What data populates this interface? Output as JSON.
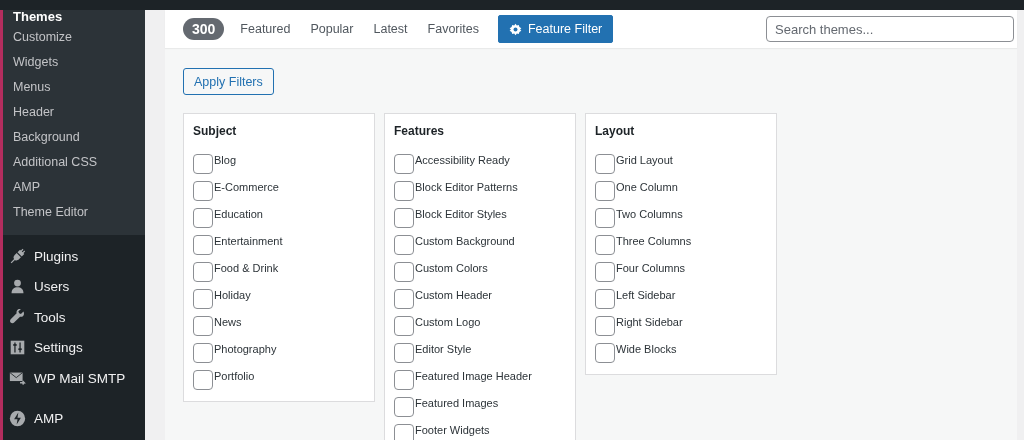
{
  "sidebar": {
    "submenu": [
      {
        "label": "Themes",
        "selected": true
      },
      {
        "label": "Customize",
        "selected": false
      },
      {
        "label": "Widgets",
        "selected": false
      },
      {
        "label": "Menus",
        "selected": false
      },
      {
        "label": "Header",
        "selected": false
      },
      {
        "label": "Background",
        "selected": false
      },
      {
        "label": "Additional CSS",
        "selected": false
      },
      {
        "label": "AMP",
        "selected": false
      },
      {
        "label": "Theme Editor",
        "selected": false
      }
    ],
    "menu": [
      {
        "label": "Plugins",
        "kind": "plugin"
      },
      {
        "label": "Users",
        "kind": "user"
      },
      {
        "label": "Tools",
        "kind": "wrench"
      },
      {
        "label": "Settings",
        "kind": "sliders"
      },
      {
        "label": "WP Mail SMTP",
        "kind": "mail"
      },
      {
        "label": "AMP",
        "kind": "bolt"
      }
    ]
  },
  "filter_bar": {
    "count": "300",
    "tabs": [
      {
        "label": "Featured",
        "selected": false
      },
      {
        "label": "Popular",
        "selected": false
      },
      {
        "label": "Latest",
        "selected": false
      },
      {
        "label": "Favorites",
        "selected": false
      },
      {
        "label": "Feature Filter",
        "selected": true
      }
    ],
    "search": {
      "placeholder": "Search themes..."
    }
  },
  "apply_button": "Apply Filters",
  "groups": [
    {
      "title": "Subject",
      "options": [
        {
          "label": "Blog",
          "checked": false
        },
        {
          "label": "E-Commerce",
          "checked": false
        },
        {
          "label": "Education",
          "checked": false
        },
        {
          "label": "Entertainment",
          "checked": false
        },
        {
          "label": "Food & Drink",
          "checked": false
        },
        {
          "label": "Holiday",
          "checked": false
        },
        {
          "label": "News",
          "checked": false
        },
        {
          "label": "Photography",
          "checked": false
        },
        {
          "label": "Portfolio",
          "checked": false
        }
      ]
    },
    {
      "title": "Features",
      "options": [
        {
          "label": "Accessibility Ready",
          "checked": false
        },
        {
          "label": "Block Editor Patterns",
          "checked": false
        },
        {
          "label": "Block Editor Styles",
          "checked": false
        },
        {
          "label": "Custom Background",
          "checked": false
        },
        {
          "label": "Custom Colors",
          "checked": false
        },
        {
          "label": "Custom Header",
          "checked": false
        },
        {
          "label": "Custom Logo",
          "checked": false
        },
        {
          "label": "Editor Style",
          "checked": false
        },
        {
          "label": "Featured Image Header",
          "checked": false
        },
        {
          "label": "Featured Images",
          "checked": false
        },
        {
          "label": "Footer Widgets",
          "checked": false
        }
      ]
    },
    {
      "title": "Layout",
      "options": [
        {
          "label": "Grid Layout",
          "checked": false
        },
        {
          "label": "One Column",
          "checked": false
        },
        {
          "label": "Two Columns",
          "checked": false
        },
        {
          "label": "Three Columns",
          "checked": false
        },
        {
          "label": "Four Columns",
          "checked": false
        },
        {
          "label": "Left Sidebar",
          "checked": false
        },
        {
          "label": "Right Sidebar",
          "checked": false
        },
        {
          "label": "Wide Blocks",
          "checked": false
        }
      ]
    }
  ]
}
